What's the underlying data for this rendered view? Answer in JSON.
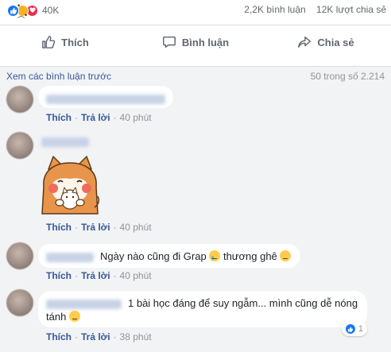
{
  "post_stats": {
    "reaction_icons": [
      "like-icon",
      "sad-icon",
      "love-icon"
    ],
    "reaction_count": "40K",
    "comments_count": "2,2K bình luận",
    "shares_count": "12K lượt chia sẻ"
  },
  "actions": {
    "like_label": "Thích",
    "comment_label": "Bình luận",
    "share_label": "Chia sẻ"
  },
  "comments_header": {
    "prev_link": "Xem các bình luận trước",
    "count": "50 trong số 2.214"
  },
  "comment_meta": {
    "like": "Thích",
    "reply": "Trả lời",
    "separator": "·"
  },
  "comments": [
    {
      "time": "40 phút"
    },
    {
      "time": "40 phút",
      "sticker": "shiba-dog-holding-cat-sticker"
    },
    {
      "time": "40 phút",
      "text_1": "Ngày nào cũng đi Grap",
      "text_2": "thương ghê"
    },
    {
      "time": "38 phút",
      "text_1": "1 bài học đáng để suy ngẫm... mình cũng dễ nóng",
      "text_2": "tánh",
      "like_count": "1"
    }
  ],
  "colors": {
    "link": "#385898",
    "like_blue": "#1877f2",
    "love_red": "#f0284a",
    "sad_yellow": "#f7b125",
    "comments_bg": "#f2f3f5"
  }
}
